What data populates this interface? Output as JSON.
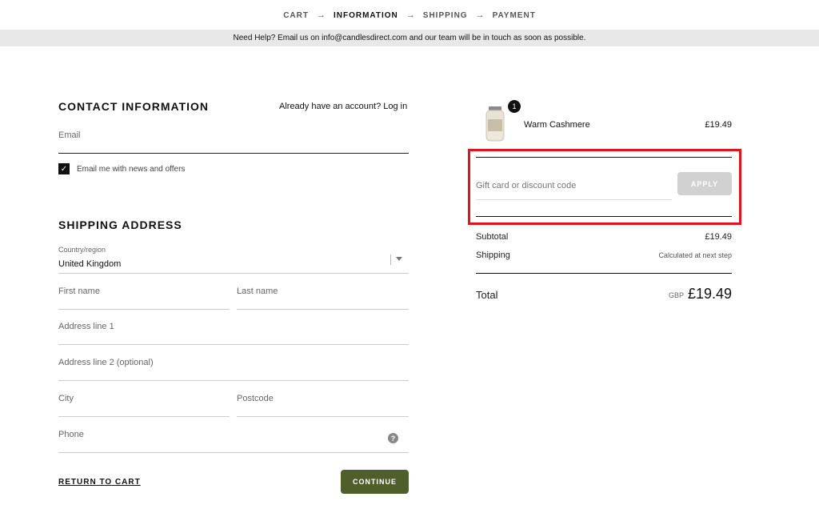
{
  "breadcrumb": {
    "steps": [
      "CART",
      "INFORMATION",
      "SHIPPING",
      "PAYMENT"
    ],
    "arrow": "→",
    "active_index": 1
  },
  "help_bar": {
    "text": "Need Help? Email us on info@candlesdirect.com and our team will be in touch as soon as possible."
  },
  "contact": {
    "title": "CONTACT INFORMATION",
    "login_prompt": "Already have an account? Log in",
    "email_label": "Email",
    "newsletter_label": "Email me with news and offers",
    "newsletter_checked": true,
    "check_glyph": "✓"
  },
  "shipping": {
    "title": "SHIPPING ADDRESS",
    "country_label": "Country/region",
    "country_value": "United Kingdom",
    "first_name": "First name",
    "last_name": "Last name",
    "address1": "Address line 1",
    "address2": "Address line 2 (optional)",
    "city": "City",
    "postcode": "Postcode",
    "phone": "Phone",
    "help_glyph": "?"
  },
  "actions": {
    "return_label": "RETURN TO CART",
    "continue_label": "CONTINUE"
  },
  "summary": {
    "product": {
      "quantity": "1",
      "name": "Warm Cashmere",
      "price": "£19.49"
    },
    "discount_placeholder": "Gift card or discount code",
    "apply_label": "APPLY",
    "subtotal_label": "Subtotal",
    "subtotal_value": "£19.49",
    "shipping_label": "Shipping",
    "shipping_value": "Calculated at next step",
    "total_label": "Total",
    "currency": "GBP",
    "total_value": "£19.49"
  },
  "colors": {
    "continue_button": "#4f5f2c",
    "highlight_border": "#e0141c",
    "apply_button": "#d1d1d1"
  }
}
